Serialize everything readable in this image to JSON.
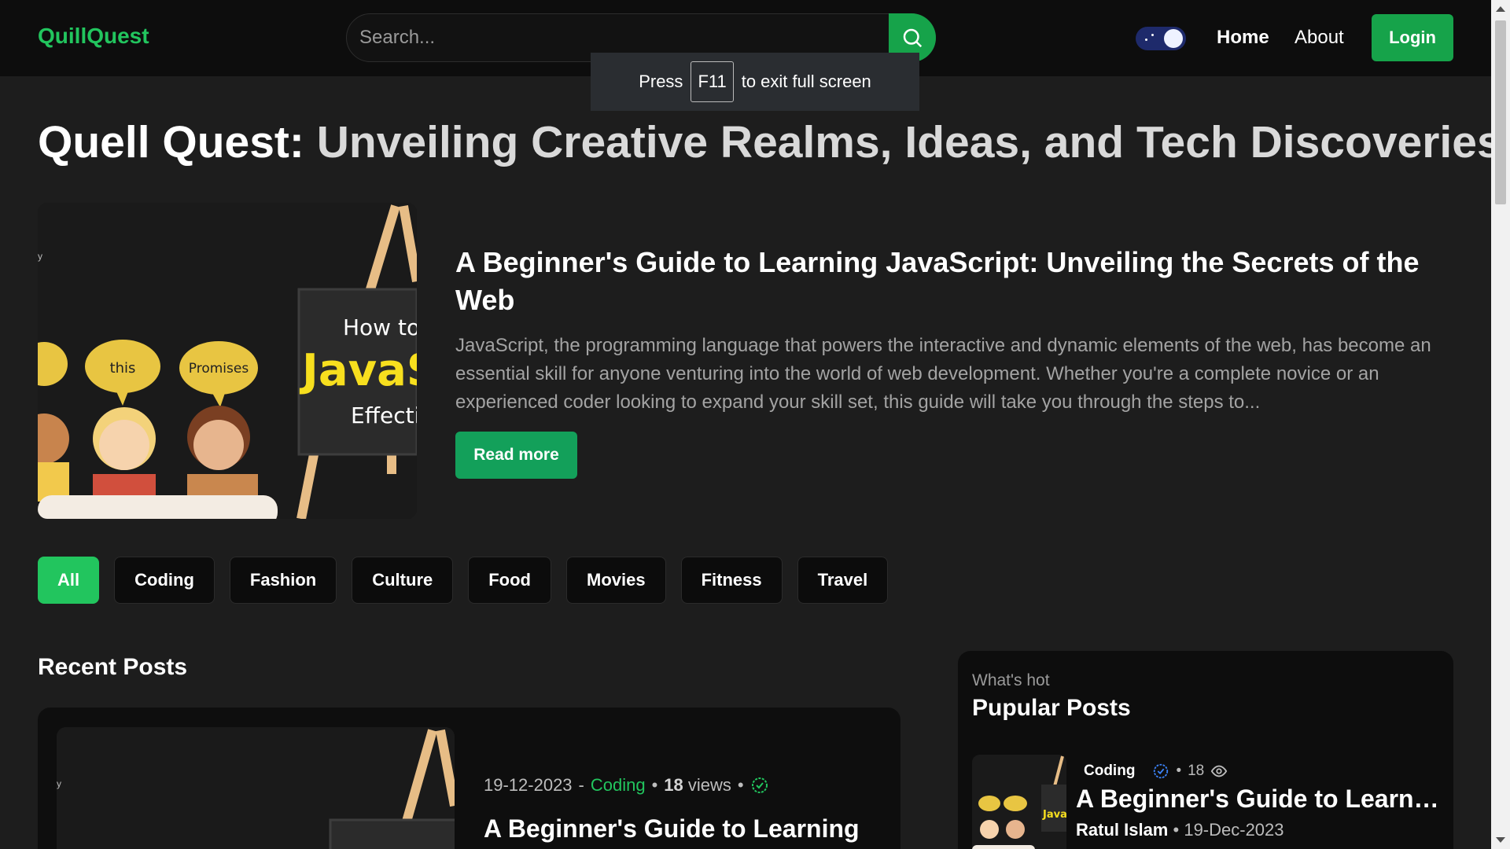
{
  "header": {
    "logo": "QuillQuest",
    "search_placeholder": "Search...",
    "nav_home": "Home",
    "nav_about": "About",
    "login_label": "Login"
  },
  "fullscreen_notice": {
    "press": "Press",
    "key": "F11",
    "rest": "to exit full screen"
  },
  "hero": {
    "title_bold": "Quell Quest:",
    "title_rest": "Unveiling Creative Realms, Ideas, and Tech Discoveries"
  },
  "featured": {
    "title": "A Beginner's Guide to Learning JavaScript: Unveiling the Secrets of the Web",
    "excerpt": "JavaScript, the programming language that powers the interactive and dynamic elements of the web, has become an essential skill for anyone venturing into the world of web development. Whether you're a complete novice or an experienced coder looking to expand your skill set, this guide will take you through the steps to...",
    "read_more": "Read more",
    "image_text": {
      "bubble1": "this",
      "bubble2": "Promises",
      "board_line1": "How to L",
      "board_line2": "JavaSc",
      "board_line3": "Effectiv"
    }
  },
  "categories": [
    {
      "label": "All",
      "active": true
    },
    {
      "label": "Coding"
    },
    {
      "label": "Fashion"
    },
    {
      "label": "Culture"
    },
    {
      "label": "Food"
    },
    {
      "label": "Movies"
    },
    {
      "label": "Fitness"
    },
    {
      "label": "Travel"
    }
  ],
  "recent": {
    "heading": "Recent Posts",
    "post": {
      "date": "19-12-2023",
      "category": "Coding",
      "views_count": "18",
      "views_label": "views",
      "title": "A Beginner's Guide to Learning"
    }
  },
  "popular": {
    "kicker": "What's hot",
    "heading": "Pupular Posts",
    "post": {
      "category": "Coding",
      "views": "18",
      "title": "A Beginner's Guide to Learnin...",
      "author": "Ratul Islam",
      "date": "19-Dec-2023"
    }
  },
  "colors": {
    "accent": "#22c55e",
    "background": "#1d1d1d",
    "header_bg": "#0d0d0d"
  }
}
